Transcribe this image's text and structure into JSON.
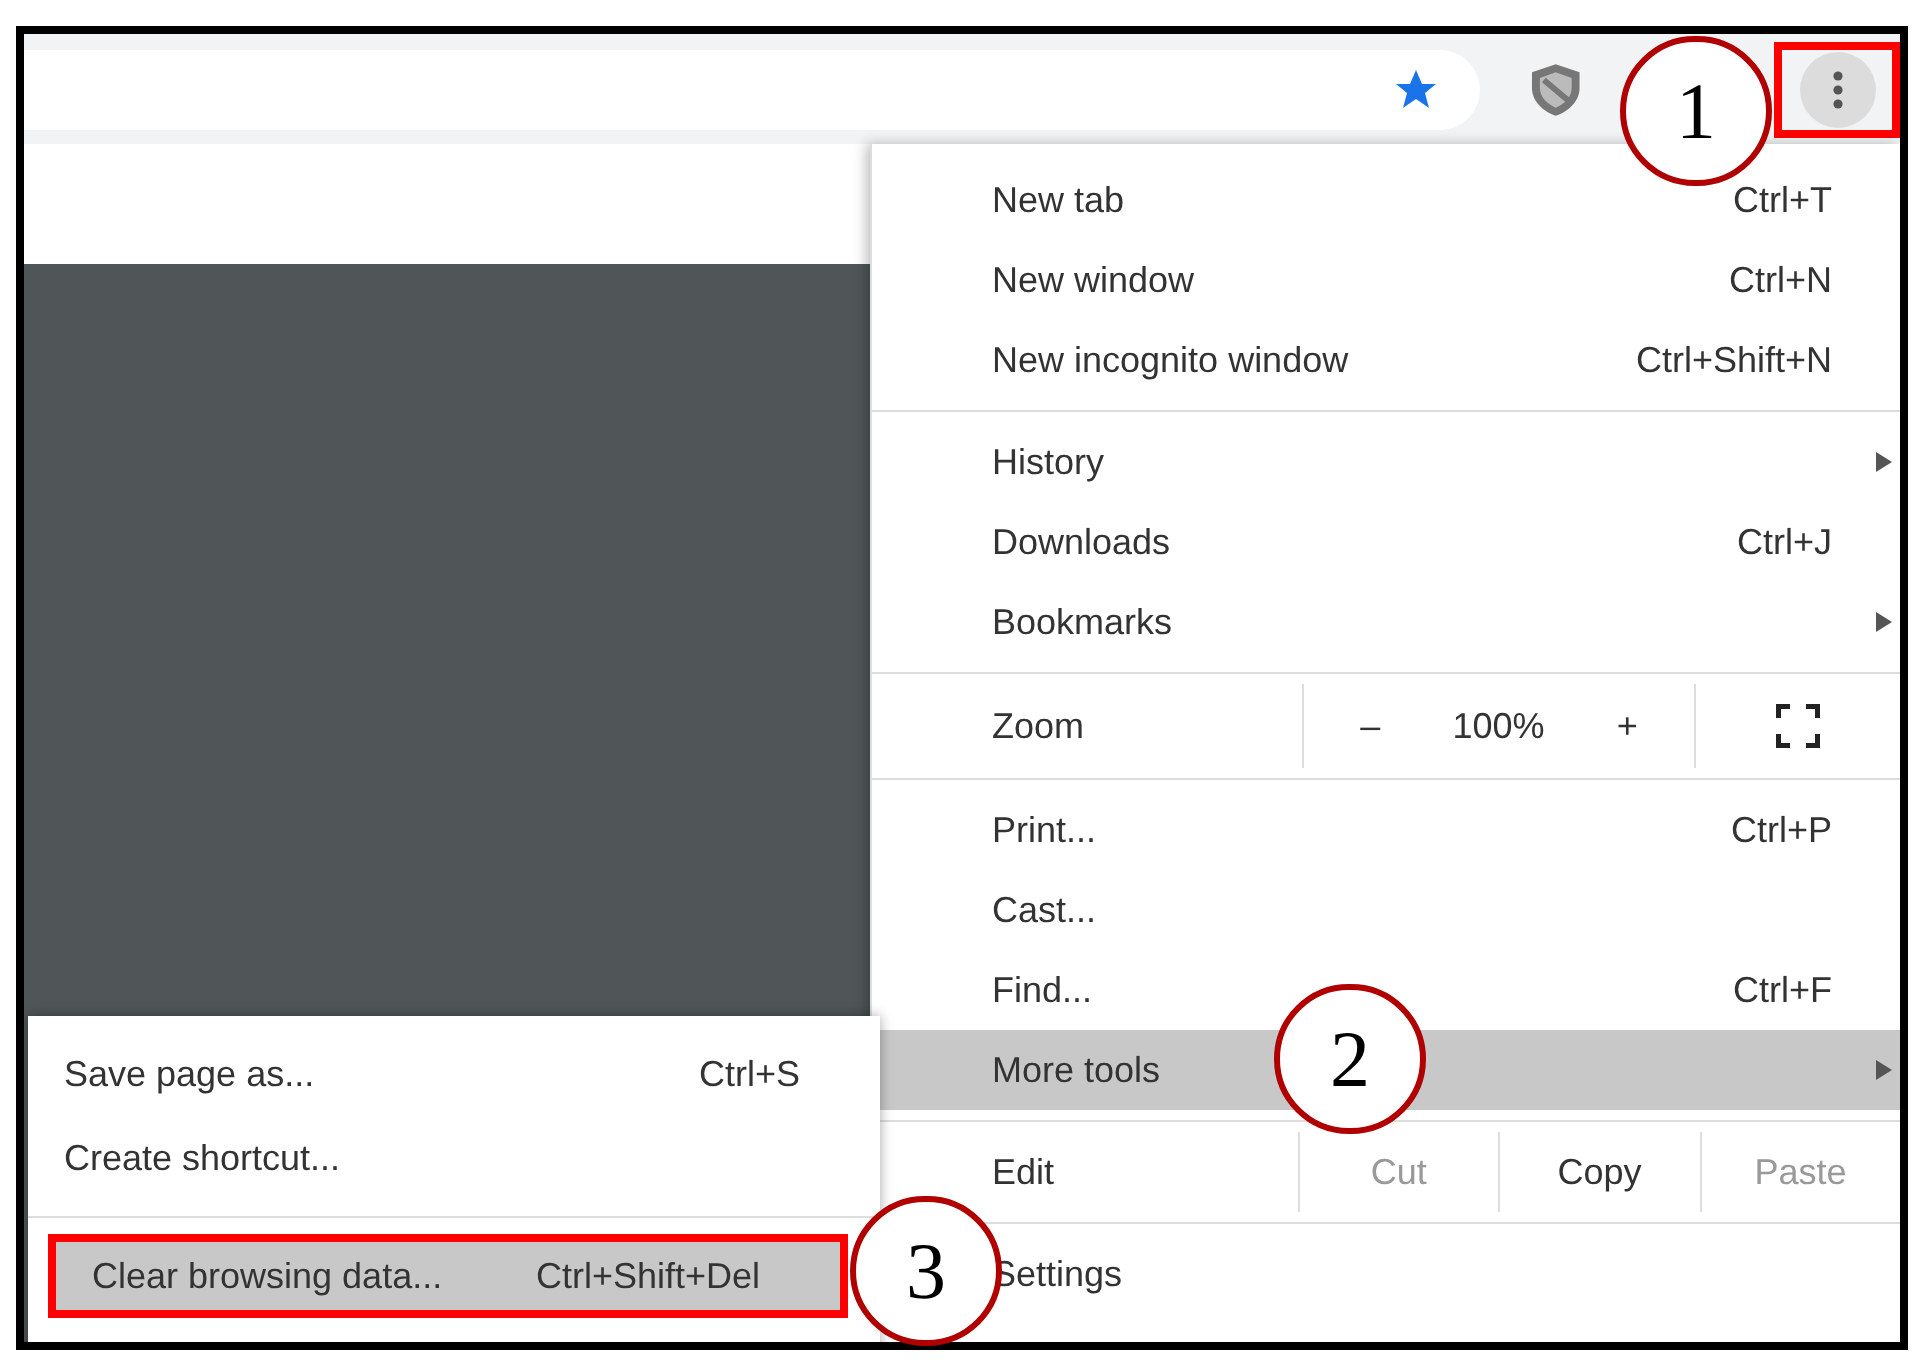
{
  "toolbar": {
    "menu_button": {
      "outlined": true
    }
  },
  "menu": {
    "items": [
      {
        "kind": "item",
        "label": "New tab",
        "shortcut": "Ctrl+T",
        "submenu": false,
        "selected": false
      },
      {
        "kind": "item",
        "label": "New window",
        "shortcut": "Ctrl+N",
        "submenu": false,
        "selected": false
      },
      {
        "kind": "item",
        "label": "New incognito window",
        "shortcut": "Ctrl+Shift+N",
        "submenu": false,
        "selected": false
      },
      {
        "kind": "divider"
      },
      {
        "kind": "item",
        "label": "History",
        "submenu": true,
        "selected": false
      },
      {
        "kind": "item",
        "label": "Downloads",
        "shortcut": "Ctrl+J",
        "submenu": false,
        "selected": false
      },
      {
        "kind": "item",
        "label": "Bookmarks",
        "submenu": true,
        "selected": false
      },
      {
        "kind": "divider"
      },
      {
        "kind": "zoom",
        "label": "Zoom",
        "minus": "–",
        "value": "100%",
        "plus": "+"
      },
      {
        "kind": "divider"
      },
      {
        "kind": "item",
        "label": "Print...",
        "shortcut": "Ctrl+P",
        "submenu": false,
        "selected": false
      },
      {
        "kind": "item",
        "label": "Cast...",
        "submenu": false,
        "selected": false
      },
      {
        "kind": "item",
        "label": "Find...",
        "shortcut": "Ctrl+F",
        "submenu": false,
        "selected": false
      },
      {
        "kind": "item",
        "label": "More tools",
        "submenu": true,
        "selected": true
      },
      {
        "kind": "divider"
      },
      {
        "kind": "edit",
        "label": "Edit",
        "actions": [
          {
            "label": "Cut",
            "disabled": true
          },
          {
            "label": "Copy",
            "disabled": false
          },
          {
            "label": "Paste",
            "disabled": true
          }
        ]
      },
      {
        "kind": "divider"
      },
      {
        "kind": "item",
        "label": "Settings",
        "submenu": false,
        "selected": false
      }
    ]
  },
  "submenu": {
    "items": [
      {
        "kind": "item",
        "label": "Save page as...",
        "shortcut": "Ctrl+S",
        "selected": false,
        "outlined": false
      },
      {
        "kind": "item",
        "label": "Create shortcut...",
        "selected": false,
        "outlined": false
      },
      {
        "kind": "divider"
      },
      {
        "kind": "item",
        "label": "Clear browsing data...",
        "shortcut": "Ctrl+Shift+Del",
        "selected": true,
        "outlined": true
      }
    ]
  },
  "annotations": [
    {
      "label": "1"
    },
    {
      "label": "2"
    },
    {
      "label": "3"
    }
  ]
}
